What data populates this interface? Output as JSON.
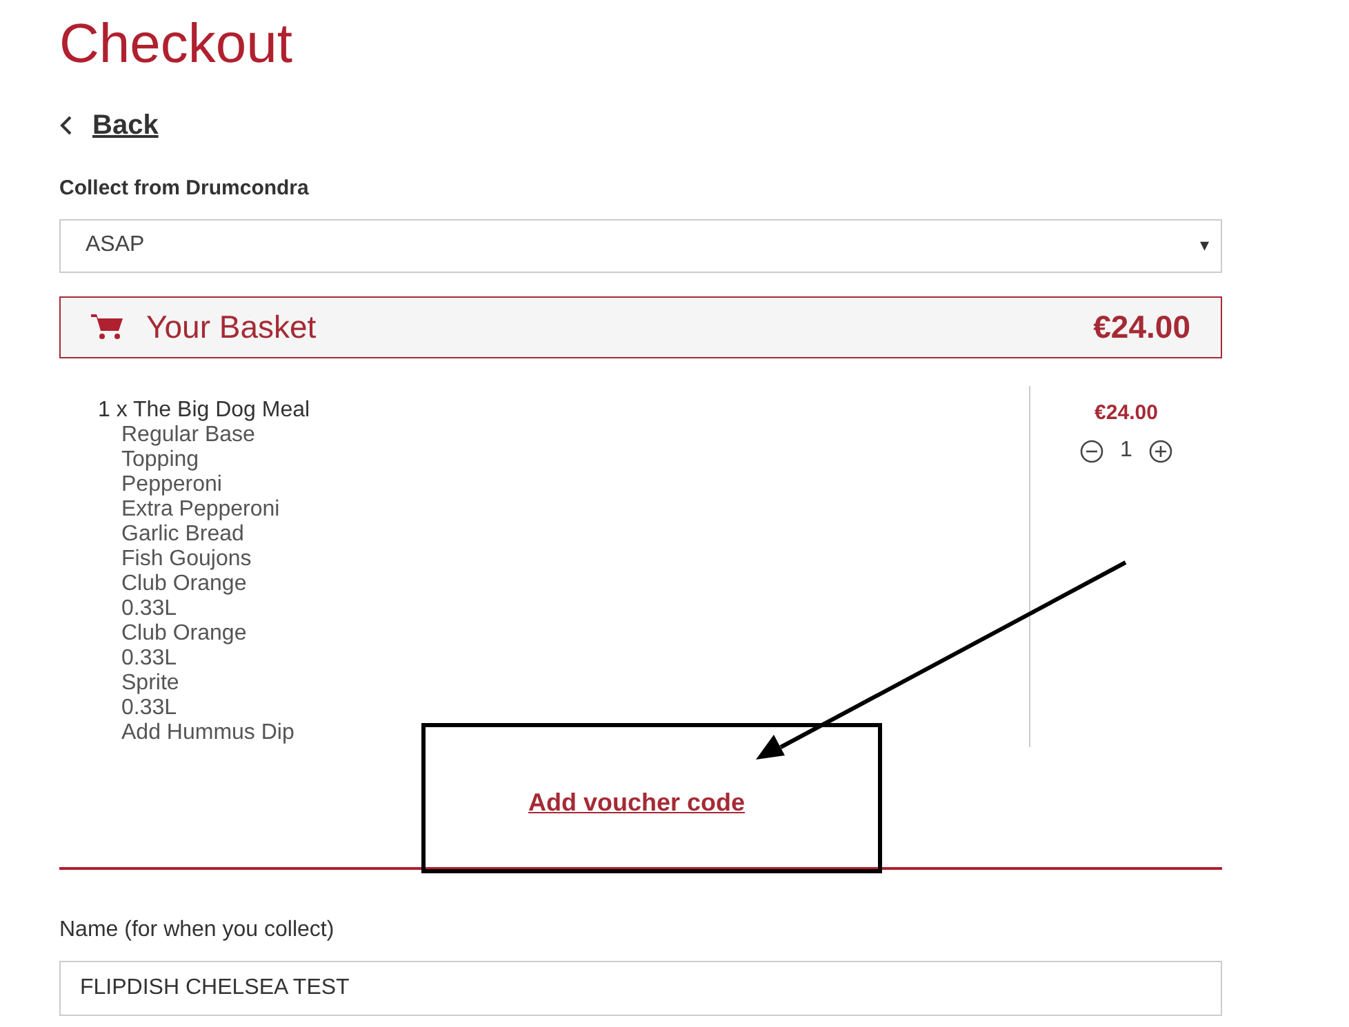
{
  "page_title": "Checkout",
  "back_link": "Back",
  "collect": {
    "label": "Collect from Drumcondra",
    "value": "ASAP",
    "caret": "▾"
  },
  "basket": {
    "title": "Your Basket",
    "total": "€24.00",
    "items": [
      {
        "title": "1 x The Big Dog Meal",
        "price": "€24.00",
        "quantity": "1",
        "options": [
          "Regular Base",
          "Topping",
          "Pepperoni",
          "Extra Pepperoni",
          "Garlic Bread",
          "Fish Goujons",
          "Club Orange",
          "0.33L",
          "Club Orange",
          "0.33L",
          "Sprite",
          "0.33L",
          "Add Hummus Dip"
        ]
      }
    ]
  },
  "voucher_link": "Add voucher code",
  "name_field": {
    "label": "Name (for when you collect)",
    "value": "FLIPDISH CHELSEA TEST"
  }
}
